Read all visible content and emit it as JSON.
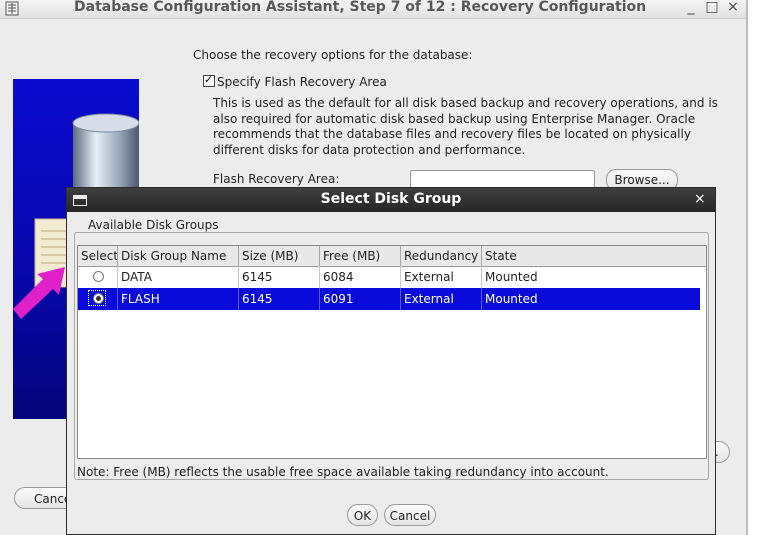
{
  "window": {
    "title": "Database Configuration Assistant, Step 7 of 12 : Recovery Configuration",
    "min": "_",
    "max": "□",
    "close": "×"
  },
  "recovery": {
    "intro": "Choose the recovery options for the database:",
    "checkbox_label": "Specify Flash Recovery Area",
    "checkbox_checked": true,
    "description": "This is used as the default for all disk based backup and recovery operations, and is also required for automatic disk based backup using Enterprise Manager. Oracle recommends that the database files and recovery files be located on physically different disks for data protection and performance.",
    "flash_area_label": "Flash Recovery Area:",
    "flash_area_value": "",
    "browse_label": "Browse..."
  },
  "back_buttons": {
    "cancel_partial": "Cance",
    "next_partial": "."
  },
  "dialog": {
    "title": "Select Disk Group",
    "close": "×",
    "group_label": "Available Disk Groups",
    "columns": [
      "Select",
      "Disk Group Name",
      "Size (MB)",
      "Free (MB)",
      "Redundancy",
      "State"
    ],
    "rows": [
      {
        "name": "DATA",
        "size": "6145",
        "free": "6084",
        "redundancy": "External",
        "state": "Mounted",
        "selected": false
      },
      {
        "name": "FLASH",
        "size": "6145",
        "free": "6091",
        "redundancy": "External",
        "state": "Mounted",
        "selected": true
      }
    ],
    "note": "Note:  Free (MB) reflects the usable free space available taking redundancy into account.",
    "ok_label": "OK",
    "cancel_label": "Cancel"
  },
  "colors": {
    "selection": "#0a0adb",
    "dialog_title_bg": "#2f2f2f",
    "side_image_blue": "#0707a8",
    "arrow_magenta": "#e020c8"
  }
}
